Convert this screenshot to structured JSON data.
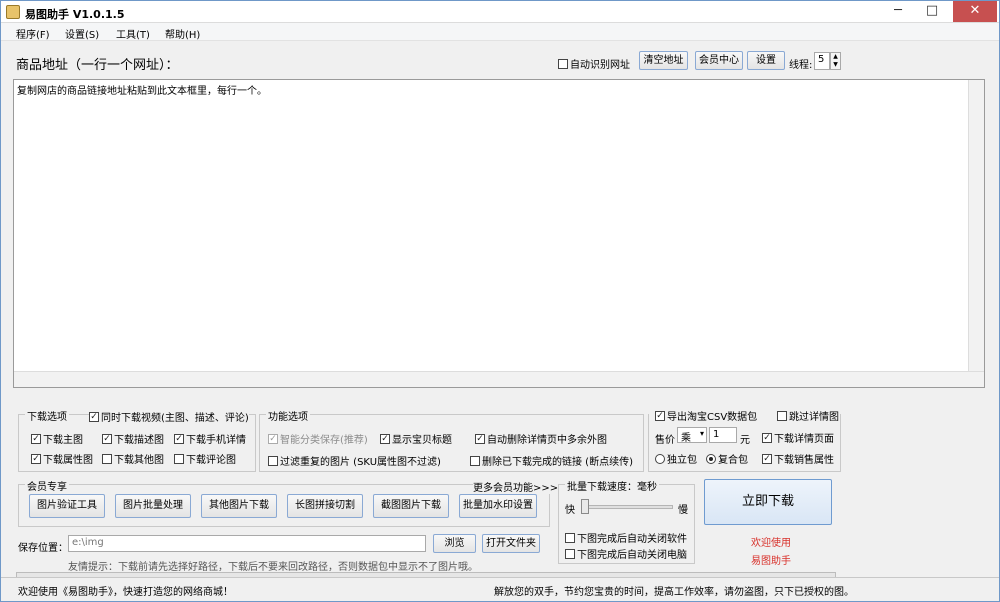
{
  "window": {
    "title": "易图助手 V1.0.1.5",
    "minimize": "─",
    "maximize": "□",
    "close": "✕"
  },
  "menu": [
    "程序(F)",
    "设置(S)",
    "工具(T)",
    "帮助(H)"
  ],
  "url_section": {
    "label": "商品地址（一行一个网址）：",
    "auto_monitor_label": "自动识别网址",
    "clear_button": "清空地址",
    "member_center_button": "会员中心",
    "settings_button": "设置",
    "threads_label": "线程:",
    "threads_value": "5",
    "placeholder_text": "复制网店的商品链接地址粘贴到此文本框里，每行一个。"
  },
  "download_options": {
    "title": "下载选项",
    "items": [
      {
        "label": "同时下载视频(主图、描述、评论)",
        "checked": true
      },
      {
        "label": "下载主图",
        "checked": true
      },
      {
        "label": "下载描述图",
        "checked": true
      },
      {
        "label": "下载手机详情",
        "checked": true
      },
      {
        "label": "下载属性图",
        "checked": true
      },
      {
        "label": "下载其他图",
        "checked": false
      },
      {
        "label": "下载评论图",
        "checked": false
      }
    ]
  },
  "function_options": {
    "title": "功能选项",
    "items": [
      {
        "label": "智能分类保存(推荐)",
        "checked": true,
        "disabled": true
      },
      {
        "label": "显示宝贝标题",
        "checked": true
      },
      {
        "label": "自动删除详情页中多余外图",
        "checked": true
      },
      {
        "label": "过滤重复的图片 (SKU属性图不过滤)",
        "checked": false
      },
      {
        "label": "删除已下载完成的链接 (断点续传)",
        "checked": false
      }
    ]
  },
  "csv_options": {
    "export_csv_label": "导出淘宝CSV数据包",
    "export_csv_checked": true,
    "skip_detail_label": "跳过详情图",
    "skip_detail_checked": false,
    "price_label": "售价",
    "price_op": "乘",
    "price_value": "1",
    "price_unit": "元",
    "download_detail_label": "下载详情页面",
    "download_detail_checked": true,
    "radio_single": "独立包",
    "radio_combined": "复合包",
    "radio_selected": "combined",
    "download_title_label": "下载销售属性",
    "download_title_checked": true
  },
  "member_section": {
    "title": "会员专享",
    "more_link": "更多会员功能>>>",
    "buttons": [
      "图片验证工具",
      "图片批量处理",
      "其他图片下载",
      "长图拼接切割",
      "截图图片下载",
      "批量加水印设置"
    ]
  },
  "speed_section": {
    "title": "批量下载速度：",
    "unit": "毫秒",
    "slow_label": "快",
    "fast_label": "慢",
    "speed_value": 0.05,
    "close_app_label": "下图完成后自动关闭软件",
    "shutdown_label": "下图完成后自动关闭电脑"
  },
  "download_button": "立即下载",
  "welcome_line1": "欢迎使用",
  "welcome_line2": "易图助手",
  "save_section": {
    "label": "保存位置：",
    "path": "e:\\img",
    "browse_button": "浏览",
    "open_folder_button": "打开文件夹",
    "tip": "友情提示：下载前请先选择好路径，下载后不要来回改路径，否则数据包中显示不了图片哦。"
  },
  "status": {
    "left": "欢迎使用《易图助手》，快速打造您的网络商城！",
    "right": "解放您的双手，节约您宝贵的时间，提高工作效率，请勿盗图，只下已授权的图。"
  },
  "progress": 0
}
